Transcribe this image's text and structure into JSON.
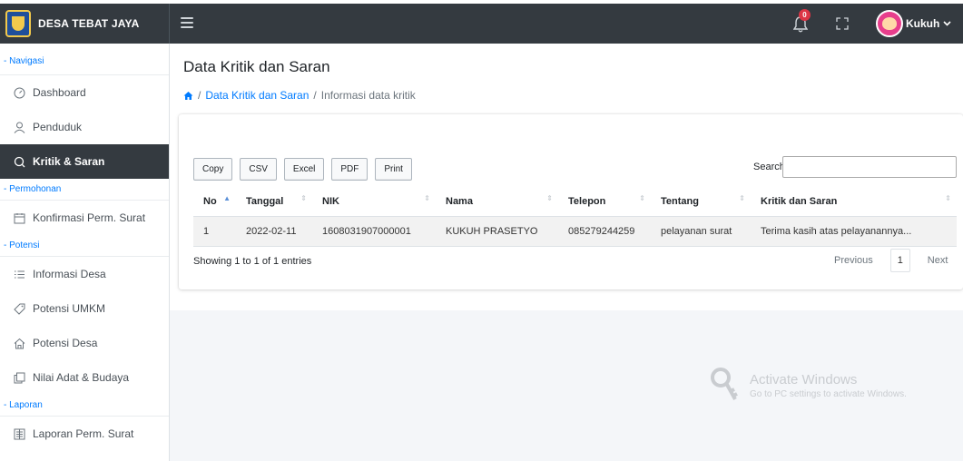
{
  "brand": {
    "title": "DESA TEBAT JAYA"
  },
  "header": {
    "notification_count": "0",
    "user_name": "Kukuh"
  },
  "sidebar": {
    "sections": [
      {
        "label": "Navigasi"
      },
      {
        "label": "Permohonan"
      },
      {
        "label": "Potensi"
      },
      {
        "label": "Laporan"
      }
    ],
    "items": [
      {
        "label": "Dashboard",
        "icon": "dashboard-icon"
      },
      {
        "label": "Penduduk",
        "icon": "user-icon"
      },
      {
        "label": "Kritik & Saran",
        "icon": "comment-icon",
        "active": true
      },
      {
        "label": "Konfirmasi Perm. Surat",
        "icon": "calendar-icon"
      },
      {
        "label": "Informasi Desa",
        "icon": "list-icon"
      },
      {
        "label": "Potensi UMKM",
        "icon": "tag-icon"
      },
      {
        "label": "Potensi Desa",
        "icon": "home-icon"
      },
      {
        "label": "Nilai Adat & Budaya",
        "icon": "copy-icon"
      },
      {
        "label": "Laporan Perm. Surat",
        "icon": "report-icon"
      }
    ]
  },
  "page": {
    "title": "Data Kritik dan Saran",
    "breadcrumb": {
      "sep": "/",
      "link": "Data Kritik dan Saran",
      "current": "Informasi data kritik"
    }
  },
  "table": {
    "buttons": [
      "Copy",
      "CSV",
      "Excel",
      "PDF",
      "Print"
    ],
    "search_label": "Search:",
    "search_value": "",
    "columns": [
      "No",
      "Tanggal",
      "NIK",
      "Nama",
      "Telepon",
      "Tentang",
      "Kritik dan Saran"
    ],
    "rows": [
      [
        "1",
        "2022-02-11",
        "1608031907000001",
        "KUKUH PRASETYO",
        "085279244259",
        "pelayanan surat",
        "Terima kasih atas pelayanannya..."
      ]
    ],
    "info": "Showing 1 to 1 of 1 entries",
    "pagination": {
      "previous": "Previous",
      "page": "1",
      "next": "Next"
    }
  },
  "watermark": {
    "title": "Activate Windows",
    "subtitle": "Go to PC settings to activate Windows."
  },
  "colors": {
    "header_bg": "#343a40",
    "accent": "#007bff",
    "badge": "#dc3545",
    "active_item_bg": "#343a40"
  }
}
